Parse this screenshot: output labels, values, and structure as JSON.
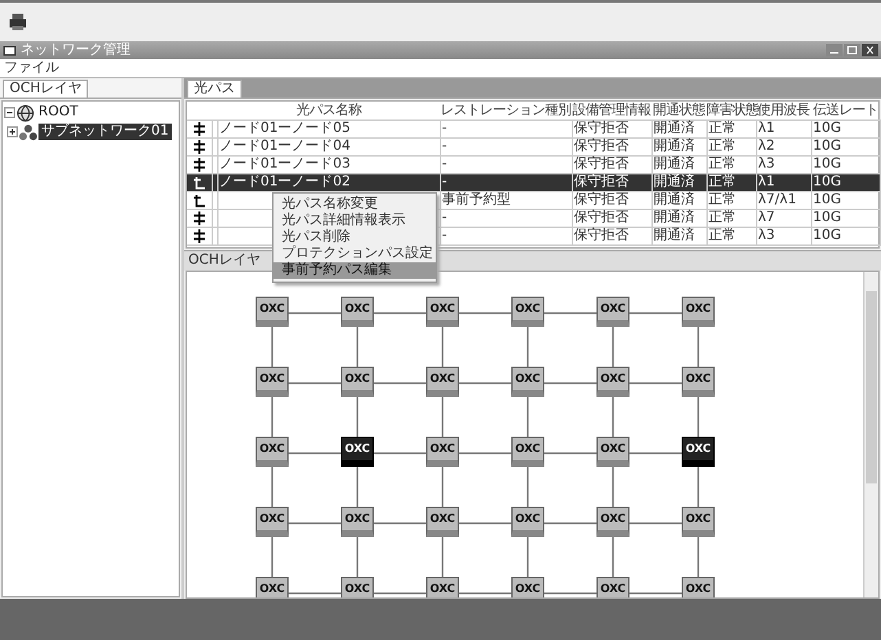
{
  "window": {
    "title": "ネットワーク管理"
  },
  "menu": [
    "ファイル"
  ],
  "left_panel": {
    "tab": "OCHレイヤ",
    "tree": [
      {
        "label": "ROOT",
        "expanded": true,
        "selected": false,
        "children": [
          {
            "label": "サブネットワーク01",
            "expanded": false,
            "selected": true
          }
        ]
      }
    ]
  },
  "path_panel": {
    "tab": "光パス",
    "columns": [
      "光パス名称",
      "レストレーション種別",
      "設備管理情報",
      "開通状態",
      "障害状態",
      "使用波長",
      "伝送レート"
    ],
    "rows": [
      {
        "kind": "through",
        "selected": false,
        "cells": [
          "ノード01ーノード05",
          "-",
          "保守拒否",
          "開通済",
          "正常",
          "λ1",
          "10G"
        ]
      },
      {
        "kind": "through",
        "selected": false,
        "cells": [
          "ノード01ーノード04",
          "-",
          "保守拒否",
          "開通済",
          "正常",
          "λ2",
          "10G"
        ]
      },
      {
        "kind": "through",
        "selected": false,
        "cells": [
          "ノード01ーノード03",
          "-",
          "保守拒否",
          "開通済",
          "正常",
          "λ3",
          "10G"
        ]
      },
      {
        "kind": "end",
        "selected": true,
        "cells": [
          "ノード01ーノード02",
          "-",
          "保守拒否",
          "開通済",
          "正常",
          "λ1",
          "10G"
        ]
      },
      {
        "kind": "end",
        "selected": false,
        "cells": [
          null,
          "事前予約型",
          "保守拒否",
          "開通済",
          "正常",
          "λ7/λ1",
          "10G"
        ]
      },
      {
        "kind": "through",
        "selected": false,
        "cells": [
          null,
          "-",
          "保守拒否",
          "開通済",
          "正常",
          "λ7",
          "10G"
        ]
      },
      {
        "kind": "through",
        "selected": false,
        "cells": [
          null,
          "-",
          "保守拒否",
          "開通済",
          "正常",
          "λ3",
          "10G"
        ]
      }
    ]
  },
  "context_menu": [
    {
      "label": "光パス名称変更",
      "selected": false
    },
    {
      "label": "光パス詳細情報表示",
      "selected": false
    },
    {
      "label": "光パス削除",
      "selected": false
    },
    {
      "label": "プロテクションパス設定",
      "selected": false
    },
    {
      "label": "事前予約パス編集",
      "selected": true
    }
  ],
  "topology": {
    "title": "OCHレイヤ",
    "nodes": [
      {
        "label": "OXC",
        "selected": false
      },
      {
        "label": "OXC",
        "selected": false
      },
      {
        "label": "OXC",
        "selected": false
      },
      {
        "label": "OXC",
        "selected": false
      },
      {
        "label": "OXC",
        "selected": false
      },
      {
        "label": "OXC",
        "selected": false
      },
      {
        "label": "OXC",
        "selected": false
      },
      {
        "label": "OXC",
        "selected": false
      },
      {
        "label": "OXC",
        "selected": false
      },
      {
        "label": "OXC",
        "selected": false
      },
      {
        "label": "OXC",
        "selected": false
      },
      {
        "label": "OXC",
        "selected": false
      },
      {
        "label": "OXC",
        "selected": false
      },
      {
        "label": "OXC",
        "selected": true
      },
      {
        "label": "OXC",
        "selected": false
      },
      {
        "label": "OXC",
        "selected": false
      },
      {
        "label": "OXC",
        "selected": false
      },
      {
        "label": "OXC",
        "selected": true
      },
      {
        "label": "OXC",
        "selected": false
      },
      {
        "label": "OXC",
        "selected": false
      },
      {
        "label": "OXC",
        "selected": false
      },
      {
        "label": "OXC",
        "selected": false
      },
      {
        "label": "OXC",
        "selected": false
      },
      {
        "label": "OXC",
        "selected": false
      },
      {
        "label": "OXC",
        "selected": false
      },
      {
        "label": "OXC",
        "selected": false
      },
      {
        "label": "OXC",
        "selected": false
      },
      {
        "label": "OXC",
        "selected": false
      },
      {
        "label": "OXC",
        "selected": false
      },
      {
        "label": "OXC",
        "selected": false
      }
    ]
  }
}
